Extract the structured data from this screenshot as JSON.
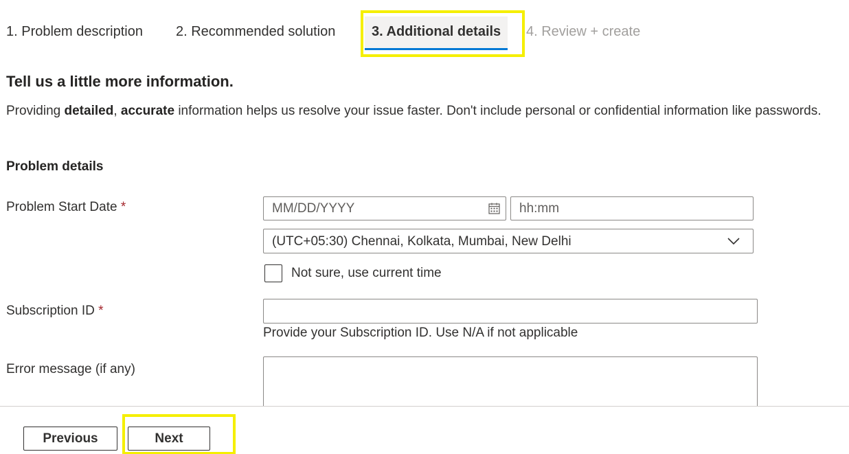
{
  "tabs": [
    {
      "label": "1. Problem description",
      "state": "done"
    },
    {
      "label": "2. Recommended solution",
      "state": "done"
    },
    {
      "label": "3. Additional details",
      "state": "active"
    },
    {
      "label": "4. Review + create",
      "state": "disabled"
    }
  ],
  "heading": "Tell us a little more information.",
  "intro": {
    "prefix": "Providing ",
    "bold1": "detailed",
    "mid": ", ",
    "bold2": "accurate",
    "suffix": " information helps us resolve your issue faster. Don't include personal or confidential information like passwords."
  },
  "section_title": "Problem details",
  "problem_start": {
    "label": "Problem Start Date",
    "required_mark": "*",
    "date_placeholder": "MM/DD/YYYY",
    "time_placeholder": "hh:mm",
    "timezone_value": "(UTC+05:30) Chennai, Kolkata, Mumbai, New Delhi",
    "checkbox_label": "Not sure, use current time",
    "checkbox_checked": false
  },
  "subscription": {
    "label": "Subscription ID",
    "required_mark": "*",
    "value": "",
    "help": "Provide your Subscription ID. Use N/A if not applicable"
  },
  "error_message": {
    "label": "Error message (if any)",
    "value": ""
  },
  "footer": {
    "previous_label": "Previous",
    "next_label": "Next"
  },
  "colors": {
    "accent": "#0078d4",
    "highlight": "#f5ef00",
    "required": "#a4262c"
  },
  "icons": {
    "calendar": "calendar-icon",
    "chevron": "chevron-down-icon"
  }
}
